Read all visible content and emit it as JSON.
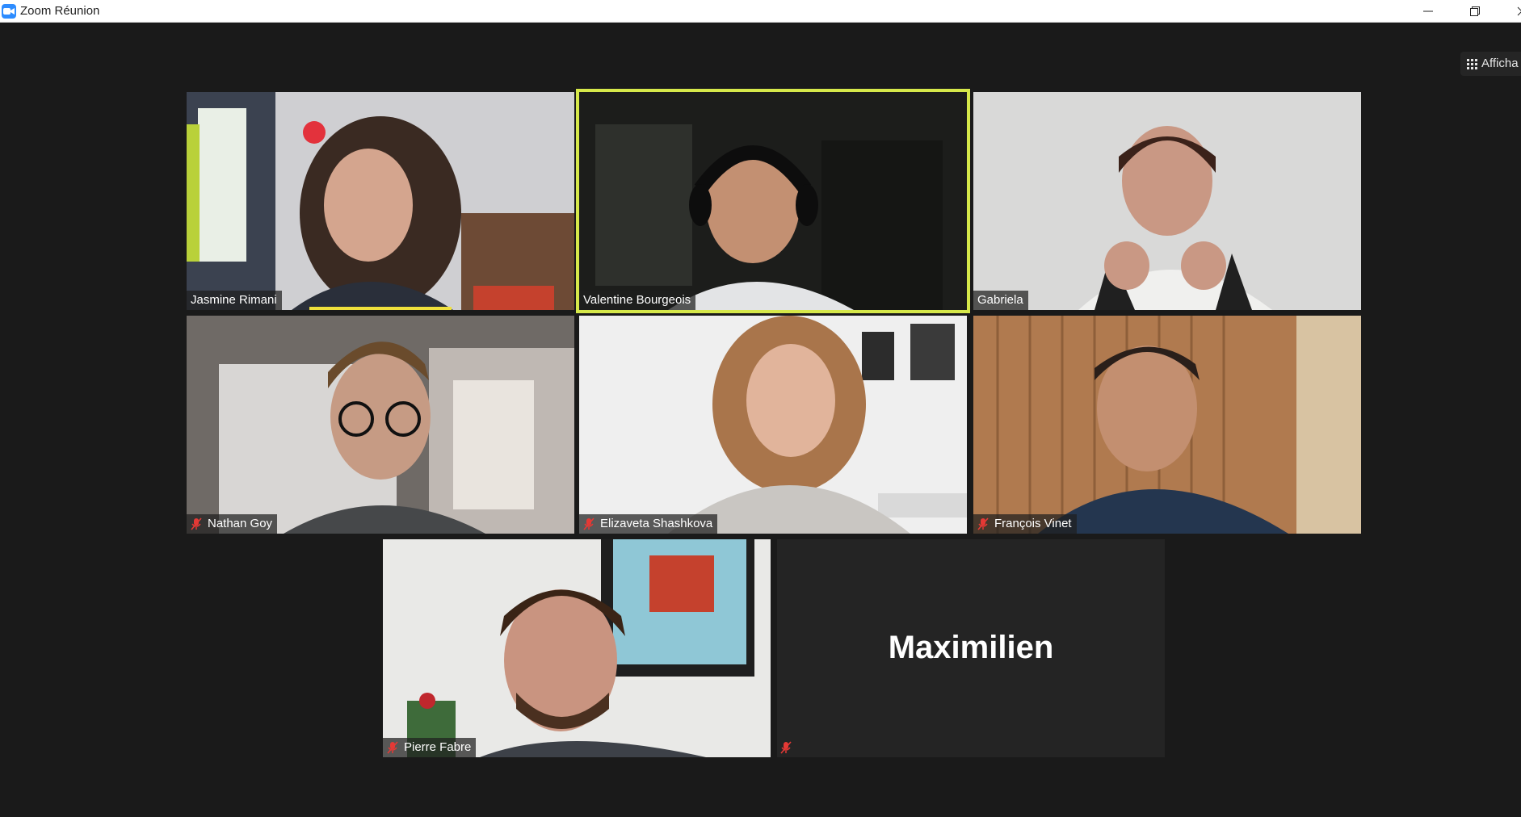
{
  "window": {
    "title": "Zoom Réunion",
    "minimize_icon": "minimize-icon",
    "restore_icon": "restore-icon",
    "close_icon": "close-icon"
  },
  "toolbar": {
    "view_label": "Afficha",
    "view_icon": "grid-icon"
  },
  "colors": {
    "active_speaker_border": "#d6e84a",
    "speaking_indicator": "#f0e13c",
    "muted_icon": "#e53935",
    "background": "#1a1a1a"
  },
  "participants": [
    {
      "name": "Jasmine Rimani",
      "muted": false,
      "speaking": true
    },
    {
      "name": "Valentine Bourgeois",
      "muted": false,
      "active_speaker": true
    },
    {
      "name": "Gabriela",
      "muted": false
    },
    {
      "name": "Nathan Goy",
      "muted": true
    },
    {
      "name": "Elizaveta Shashkova",
      "muted": true
    },
    {
      "name": "François Vinet",
      "muted": true
    },
    {
      "name": "Pierre Fabre",
      "muted": true
    },
    {
      "name": "Maximilien",
      "muted": true,
      "video_off": true
    }
  ]
}
